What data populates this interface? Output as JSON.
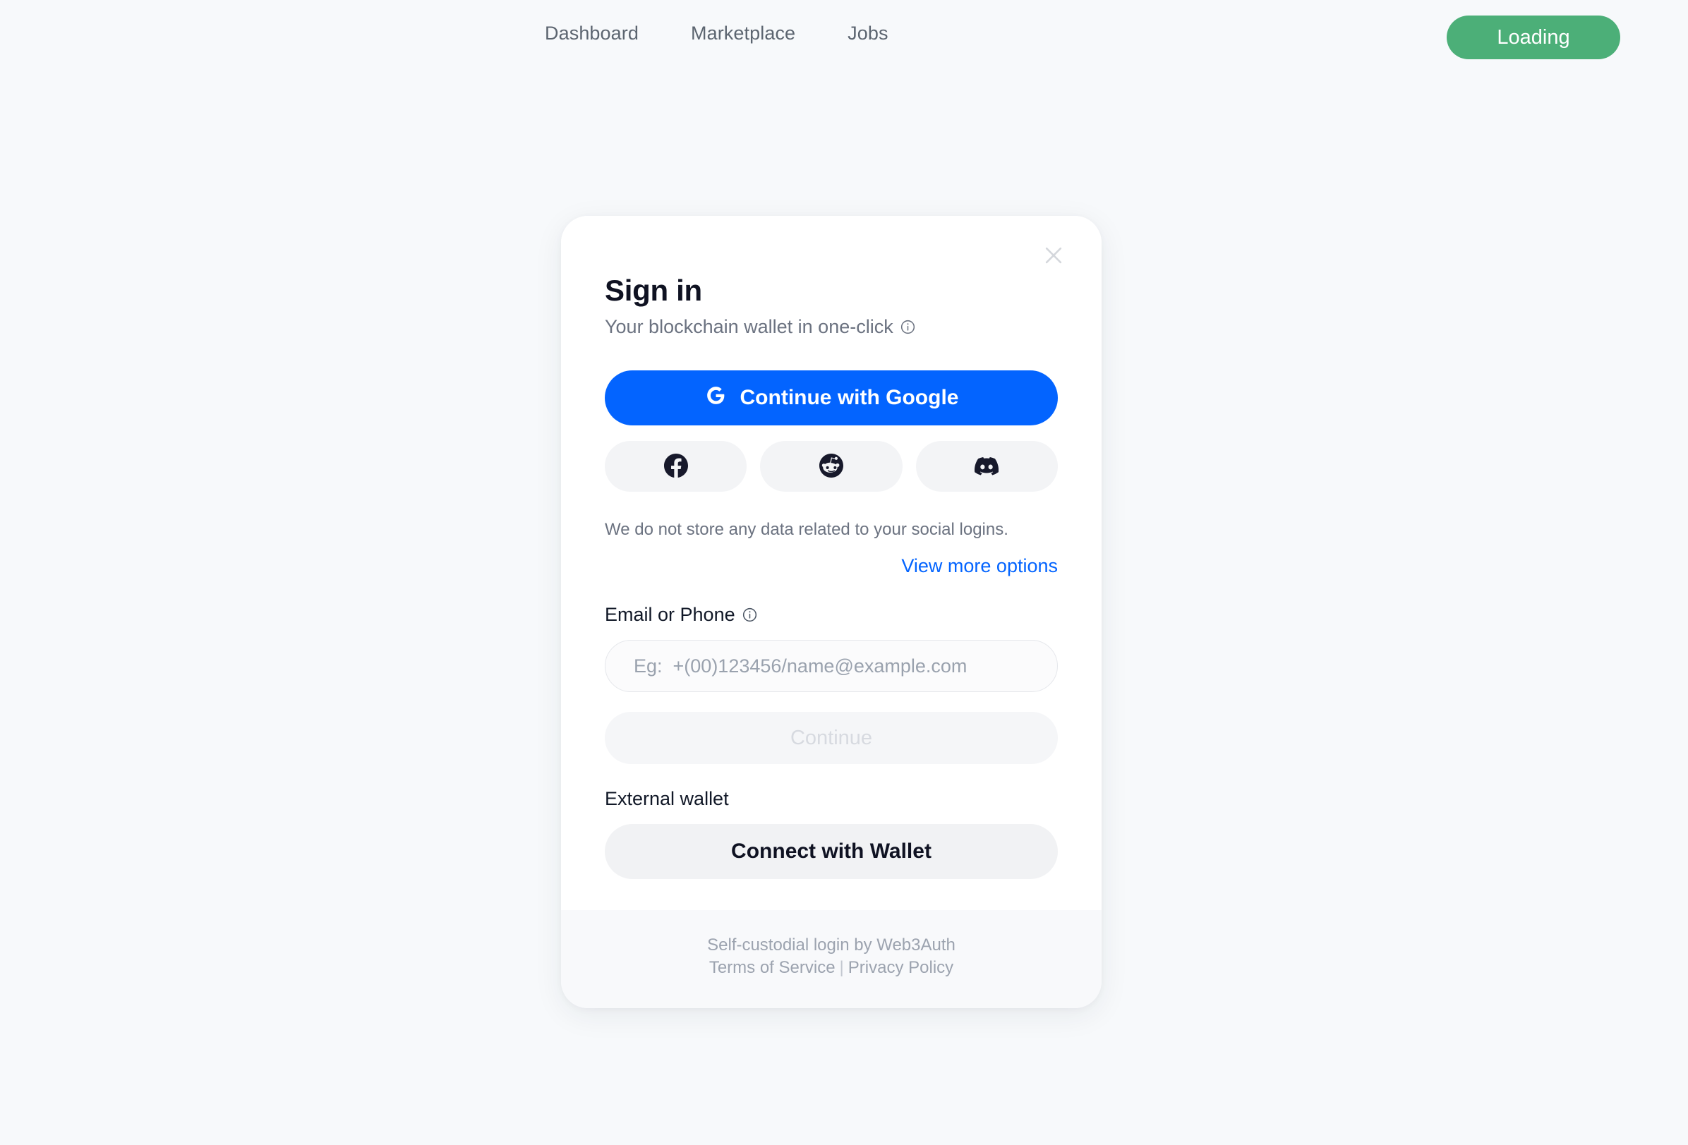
{
  "page": {
    "background_color": "#F7F9FB"
  },
  "topbar": {
    "nav": [
      {
        "label": "Dashboard",
        "name": "nav-dashboard"
      },
      {
        "label": "Marketplace",
        "name": "nav-marketplace"
      },
      {
        "label": "Jobs",
        "name": "nav-jobs"
      }
    ],
    "action_button": {
      "label": "Loading",
      "color": "#4CAF78",
      "text_color": "#FFFFFF"
    }
  },
  "modal": {
    "title": "Sign in",
    "subtitle": "Your blockchain wallet in one-click",
    "subtitle_info_icon": "info-icon",
    "close_icon": "close-icon",
    "google_button": {
      "label": "Continue with Google",
      "icon": "google-g-icon",
      "color": "#0364FF"
    },
    "social_buttons": [
      {
        "icon": "facebook-icon",
        "name": "facebook-login-button"
      },
      {
        "icon": "reddit-icon",
        "name": "reddit-login-button"
      },
      {
        "icon": "discord-icon",
        "name": "discord-login-button"
      }
    ],
    "disclaimer": "We do not store any data related to your social logins.",
    "view_more_options": {
      "label": "View more options",
      "color": "#0364FF"
    },
    "email_field": {
      "label": "Email or Phone",
      "info_icon": "info-icon",
      "placeholder": "Eg:  +(00)123456/name@example.com",
      "value": ""
    },
    "continue_button": {
      "label": "Continue",
      "disabled": true
    },
    "external_wallet": {
      "label": "External wallet",
      "button_label": "Connect with Wallet"
    },
    "footer": {
      "attribution": "Self-custodial login by Web3Auth",
      "terms": "Terms of Service",
      "separator": "|",
      "privacy": "Privacy Policy"
    }
  }
}
